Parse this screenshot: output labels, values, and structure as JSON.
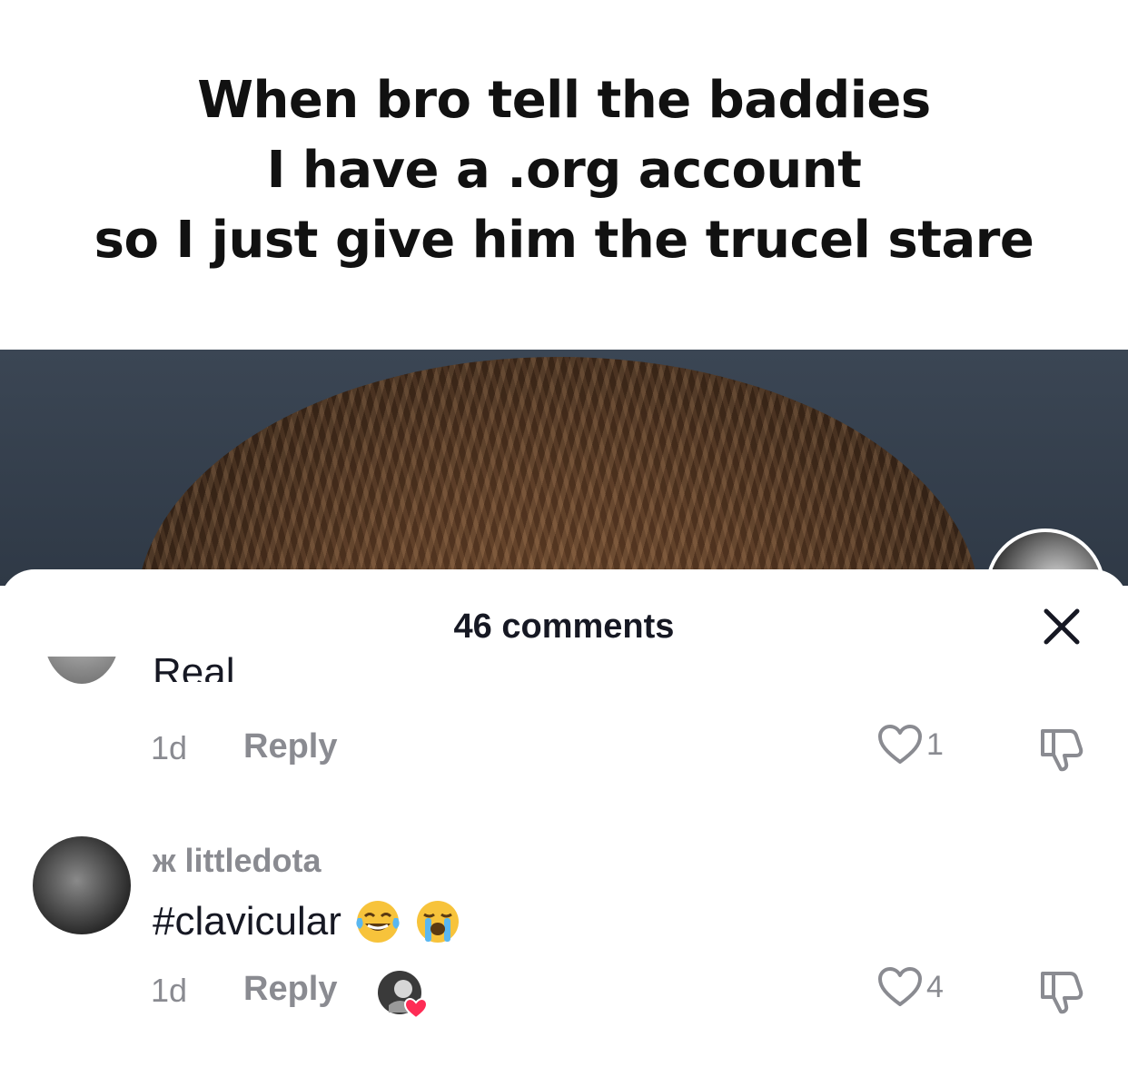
{
  "caption": {
    "lines": [
      "When bro tell the baddies",
      "I have a .org account",
      "so I just give him the trucel stare"
    ]
  },
  "comments_sheet": {
    "title": "46 comments",
    "close_icon": "close-icon"
  },
  "comments": [
    {
      "text": "Real",
      "age": "1d",
      "reply_label": "Reply",
      "likes": "1"
    },
    {
      "username_prefix": "ж",
      "username": "littledota",
      "text": "#clavicular",
      "emojis": [
        "face-with-tears-of-joy",
        "loudly-crying-face"
      ],
      "age": "1d",
      "reply_label": "Reply",
      "likes": "4",
      "creator_liked": true
    }
  ],
  "colors": {
    "text_primary": "#161823",
    "text_secondary": "#8a8b91",
    "like_heart": "#fe2c55"
  }
}
